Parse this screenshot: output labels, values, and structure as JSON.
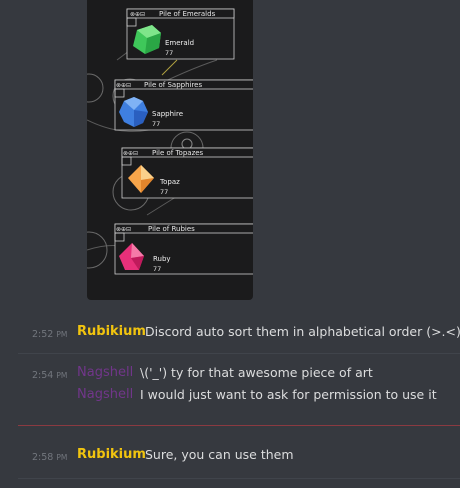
{
  "image": {
    "piles": [
      {
        "title": "Pile of Emeralds",
        "gem": "Emerald",
        "count": "77"
      },
      {
        "title": "Pile of Sapphires",
        "gem": "Sapphire",
        "count": "77"
      },
      {
        "title": "Pile of Topazes",
        "gem": "Topaz",
        "count": "77"
      },
      {
        "title": "Pile of Rubies",
        "gem": "Ruby",
        "count": "77"
      }
    ]
  },
  "messages": [
    {
      "time": "2:52",
      "ampm": "PM",
      "author": "Rubikium",
      "author_color": "#f1c40f",
      "text": "Discord auto sort them in alphabetical order (>.<) S"
    },
    {
      "time": "2:54",
      "ampm": "PM",
      "author": "Nagshell",
      "author_color": "#71368a",
      "text": "\\('_') ty for that awesome piece of art"
    },
    {
      "author": "Nagshell",
      "author_color": "#71368a",
      "text": "I would just want to ask for permission to use it"
    },
    {
      "time": "2:58",
      "ampm": "PM",
      "author": "Rubikium",
      "author_color": "#f1c40f",
      "text": "Sure, you can use them"
    }
  ],
  "colors": {
    "background": "#36393f",
    "divider": "#40444b",
    "new_divider": "#8b3a41"
  }
}
